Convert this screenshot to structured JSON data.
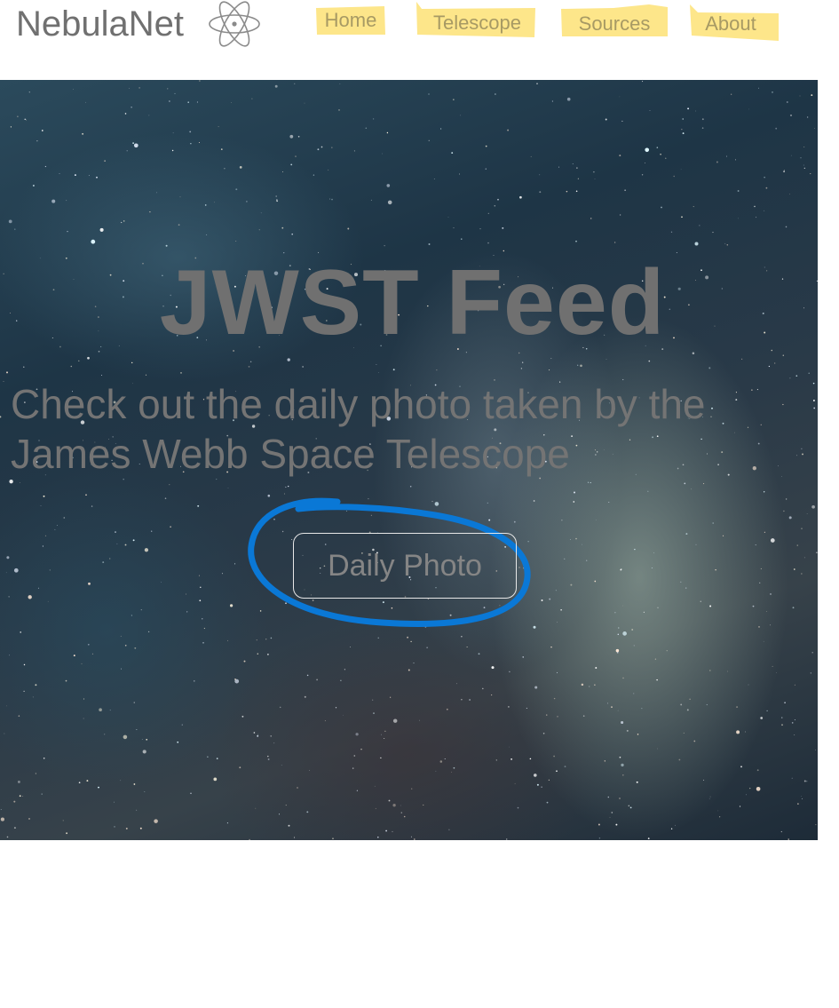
{
  "header": {
    "brand": "NebulaNet",
    "logo_icon": "atom-icon",
    "nav": [
      {
        "label": "Home"
      },
      {
        "label": "Telescope"
      },
      {
        "label": "Sources"
      },
      {
        "label": "About"
      }
    ],
    "nav_highlight_color": "#fde68a",
    "nav_text_color": "#a79a64"
  },
  "hero": {
    "title": "JWST Feed",
    "subtitle": "Check out the daily photo taken by the James Webb Space Telescope",
    "cta_label": "Daily Photo",
    "annotation_color": "#0a78d6"
  }
}
